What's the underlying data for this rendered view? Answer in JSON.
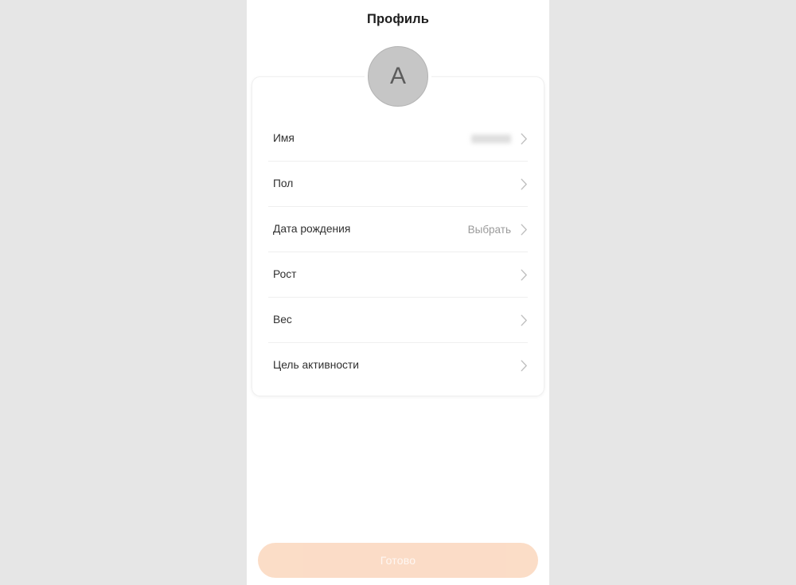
{
  "app": {
    "background_color": "#e6e6e6",
    "surface_color": "#ffffff"
  },
  "header": {
    "title": "Профиль"
  },
  "avatar": {
    "initial": "A",
    "background_color": "#c6c6c6",
    "text_color": "#5c5c5c"
  },
  "profile_card": {
    "rows": [
      {
        "label": "Имя",
        "value": "",
        "value_state": "redacted",
        "chevron": "chevron-right-icon"
      },
      {
        "label": "Пол",
        "value": "",
        "value_state": "empty",
        "chevron": "chevron-right-icon"
      },
      {
        "label": "Дата рождения",
        "value": "Выбрать",
        "value_state": "placeholder",
        "chevron": "chevron-right-icon"
      },
      {
        "label": "Рост",
        "value": "",
        "value_state": "empty",
        "chevron": "chevron-right-icon"
      },
      {
        "label": "Вес",
        "value": "",
        "value_state": "empty",
        "chevron": "chevron-right-icon"
      },
      {
        "label": "Цель активности",
        "value": "",
        "value_state": "empty",
        "chevron": "chevron-right-icon"
      }
    ]
  },
  "footer": {
    "submit_label": "Готово",
    "submit_color": "#fbdcc6",
    "submit_text_color": "#ffffff",
    "submit_enabled": false
  }
}
